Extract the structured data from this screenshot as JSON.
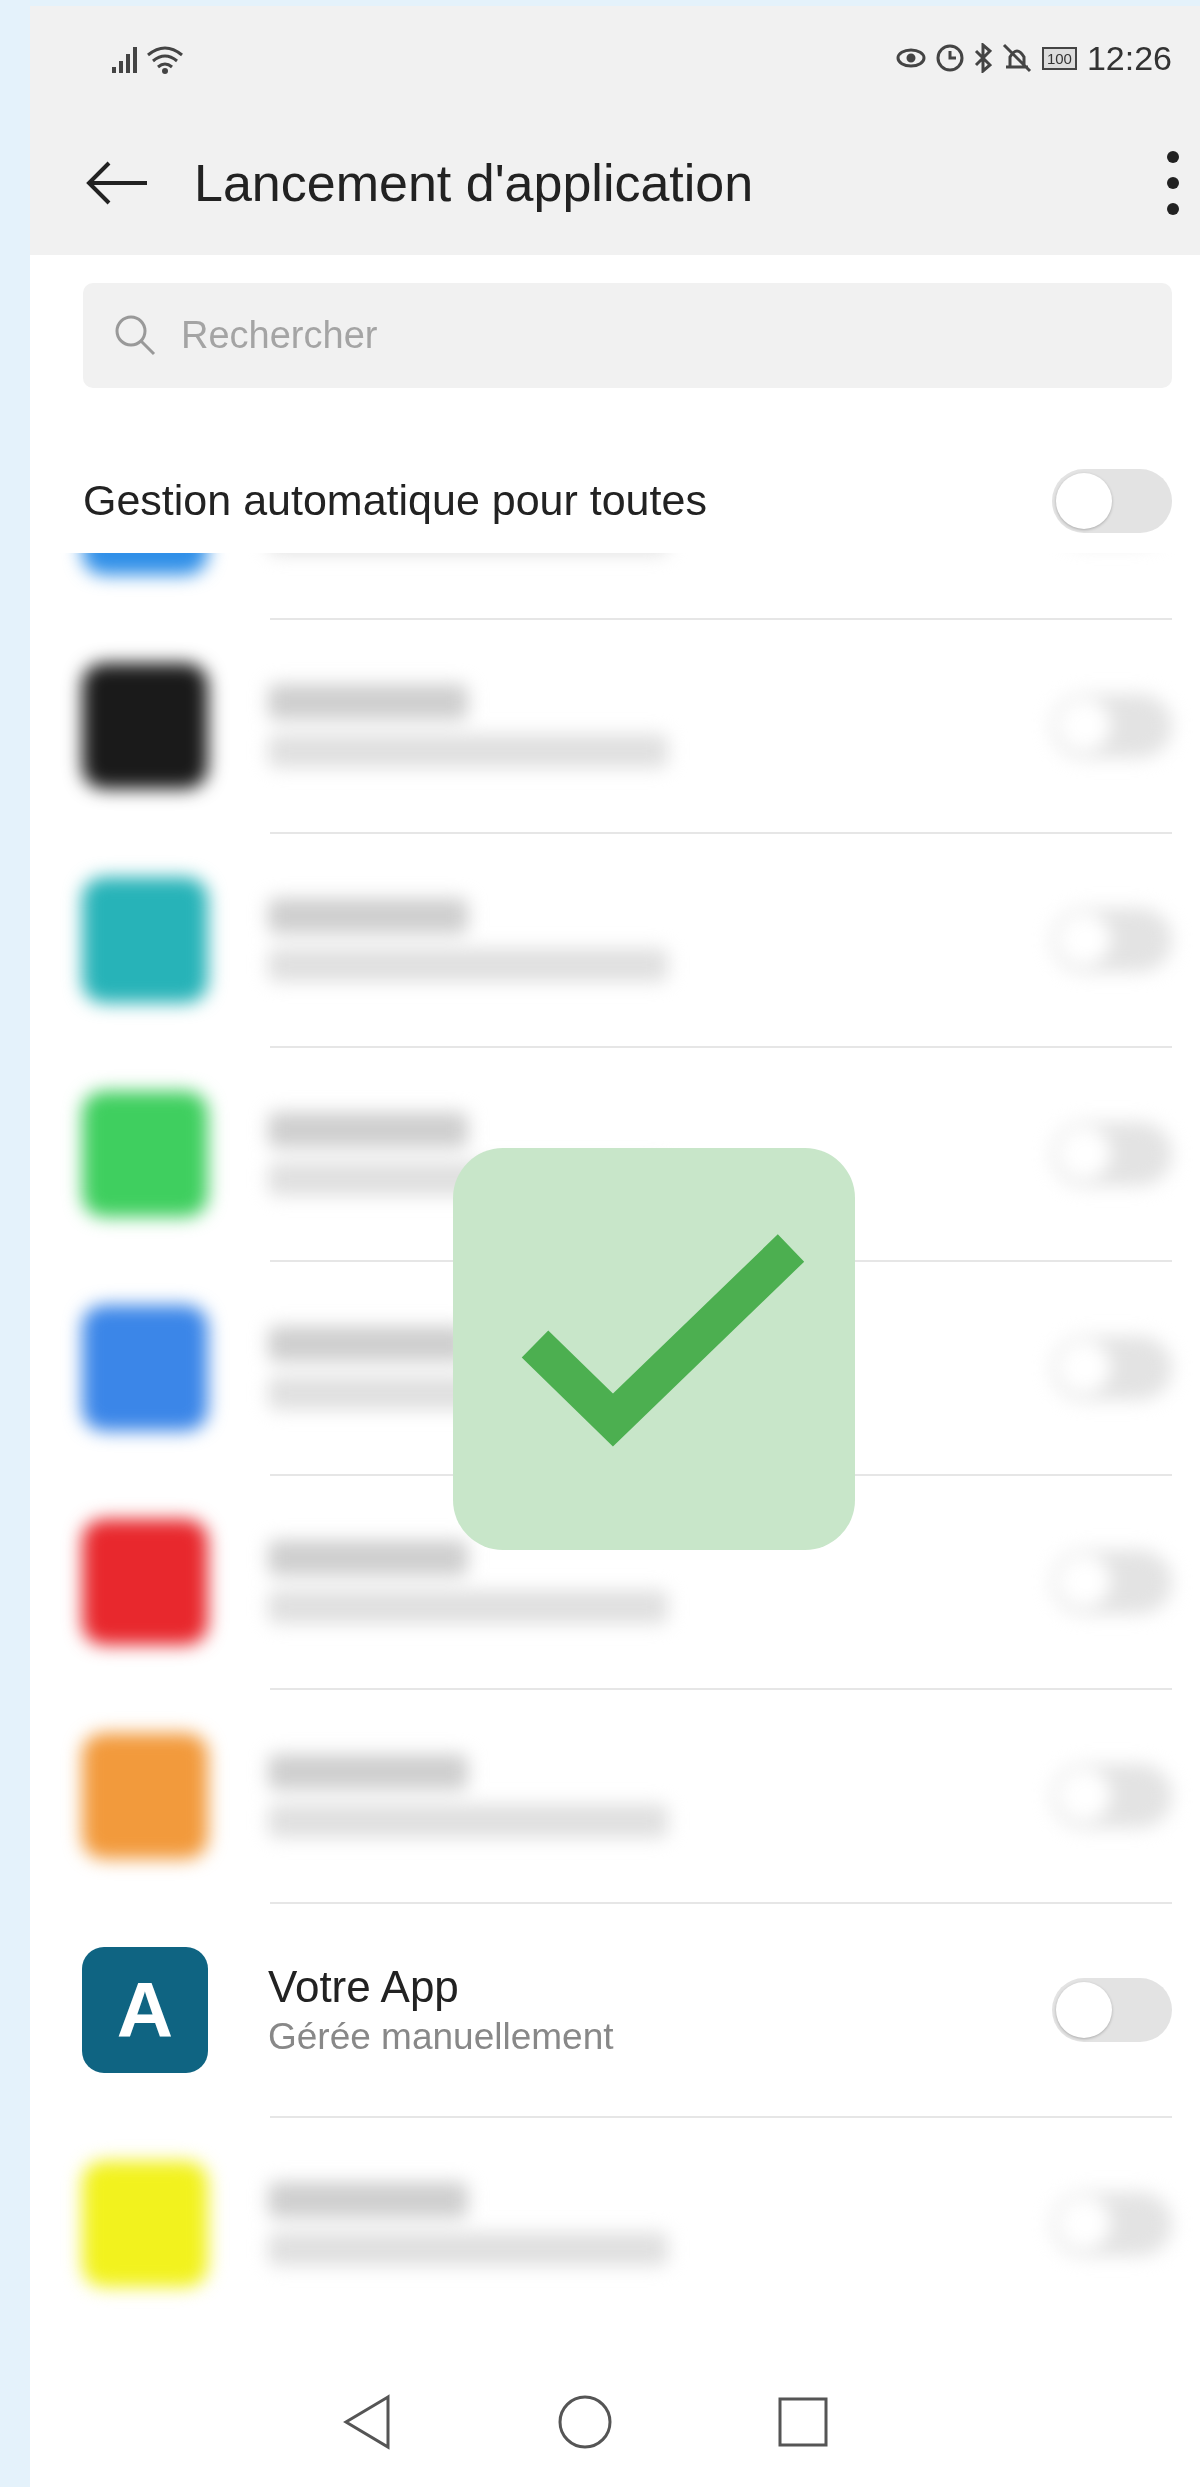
{
  "status_bar": {
    "time": "12:26",
    "battery": "100"
  },
  "app_bar": {
    "title": "Lancement d'application"
  },
  "search": {
    "placeholder": "Rechercher"
  },
  "auto_manage": {
    "label": "Gestion automatique pour toutes",
    "on": false
  },
  "apps": [
    {
      "kind": "cut",
      "color": "#2f8fe8"
    },
    {
      "kind": "blurred",
      "color": "#1a1a1a",
      "on": false
    },
    {
      "kind": "blurred",
      "color": "#27b3b8",
      "on": false
    },
    {
      "kind": "blurred",
      "color": "#3fcf5f",
      "on": false
    },
    {
      "kind": "blurred",
      "color": "#3b86e8",
      "on": false
    },
    {
      "kind": "blurred",
      "color": "#e8282d",
      "on": false
    },
    {
      "kind": "blurred",
      "color": "#f29a3c",
      "on": false
    },
    {
      "kind": "app",
      "icon_letter": "A",
      "name": "Votre App",
      "status": "Gérée manuellement",
      "on": false
    },
    {
      "kind": "blurred",
      "color": "#f2f21e",
      "on": false
    }
  ]
}
